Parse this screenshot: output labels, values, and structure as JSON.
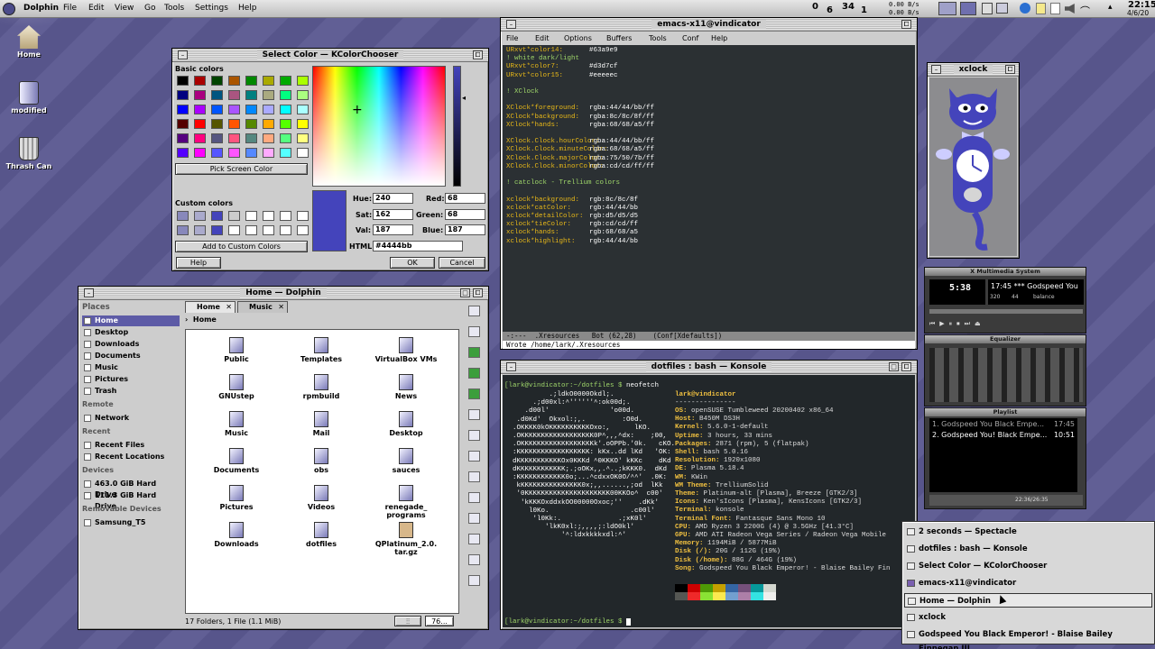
{
  "panel": {
    "app": "Dolphin",
    "menus": [
      "File",
      "Edit",
      "View",
      "Go",
      "Tools",
      "Settings",
      "Help"
    ],
    "net1": "0.00 B/s",
    "net2": "0.00 B/s",
    "clock_time": "22:15",
    "clock_date": "4/6/20",
    "indicator_a": "0",
    "indicator_b": "6",
    "indicator_c": "34",
    "indicator_d": "1"
  },
  "desktop": {
    "icons": [
      {
        "label": "Home"
      },
      {
        "label": "modified"
      },
      {
        "label": "Thrash Can"
      }
    ]
  },
  "colorchooser": {
    "title": "Select Color — KColorChooser",
    "basic_label": "Basic colors",
    "pick_label": "Pick Screen Color",
    "custom_label": "Custom colors",
    "add_label": "Add to Custom Colors",
    "hue_label": "Hue:",
    "hue": "240",
    "sat_label": "Sat:",
    "sat": "162",
    "val_label": "Val:",
    "val": "187",
    "red_label": "Red:",
    "red": "68",
    "green_label": "Green:",
    "green": "68",
    "blue_label": "Blue:",
    "blue": "187",
    "html_label": "HTML:",
    "html": "#4444bb",
    "help": "Help",
    "ok": "OK",
    "cancel": "Cancel",
    "basic_colors": [
      "#000000",
      "#aa0000",
      "#004400",
      "#aa5500",
      "#008800",
      "#aaaa00",
      "#00aa00",
      "#aaff00",
      "#000080",
      "#aa0080",
      "#005580",
      "#aa5580",
      "#008080",
      "#aaaa80",
      "#00ff80",
      "#aaff80",
      "#0000ff",
      "#aa00ff",
      "#0055ff",
      "#aa55ff",
      "#0088ff",
      "#aaaaff",
      "#00ffff",
      "#aaffff",
      "#550000",
      "#ff0000",
      "#555500",
      "#ff5500",
      "#558800",
      "#ffaa00",
      "#55ff00",
      "#ffff00",
      "#550080",
      "#ff0080",
      "#555580",
      "#ff5580",
      "#558880",
      "#ffaa80",
      "#55ff80",
      "#ffff80",
      "#5500ff",
      "#ff00ff",
      "#5555ff",
      "#ff55ff",
      "#5588ff",
      "#ffaaff",
      "#55ffff",
      "#ffffff"
    ],
    "custom_colors": [
      "#8888bb",
      "#aaaacc",
      "#4444bb",
      "#cccccc",
      "#ffffff",
      "#ffffff",
      "#ffffff",
      "#ffffff",
      "#8888bb",
      "#aaaacc",
      "#4444bb",
      "#ffffff",
      "#ffffff",
      "#ffffff",
      "#ffffff",
      "#ffffff"
    ]
  },
  "emacs": {
    "title": "emacs-x11@vindicator",
    "menus": [
      "File",
      "Edit",
      "Options",
      "Buffers",
      "Tools",
      "Conf",
      "Help"
    ],
    "lines": [
      {
        "k": "URxvt*color14:",
        "v": "#63a9e9"
      },
      {
        "c": "! white dark/light"
      },
      {
        "k": "URxvt*color7:",
        "v": "#d3d7cf"
      },
      {
        "k": "URxvt*color15:",
        "v": "#eeeeec"
      },
      {
        "c": ""
      },
      {
        "c": "! XClock"
      },
      {
        "c": ""
      },
      {
        "k": "XClock*foreground:",
        "v": "rgba:44/44/bb/ff"
      },
      {
        "k": "XClock*background:",
        "v": "rgba:8c/8c/8f/ff"
      },
      {
        "k": "XClock*hands:",
        "v": "rgba:68/68/a5/ff"
      },
      {
        "c": ""
      },
      {
        "k": "XClock.Clock.hourColor:",
        "v": "rgba:44/44/bb/ff"
      },
      {
        "k": "XClock.Clock.minuteColor:",
        "v": "rgba:68/68/a5/ff"
      },
      {
        "k": "XClock.Clock.majorColor:",
        "v": "rgba:75/50/7b/ff"
      },
      {
        "k": "XClock.Clock.minorColor:",
        "v": "rgba:cd/cd/ff/ff"
      },
      {
        "c": ""
      },
      {
        "c": "! catclock - Trellium colors"
      },
      {
        "c": ""
      },
      {
        "k": "xclock*background:",
        "v": "rgb:8c/8c/8f"
      },
      {
        "k": "xclock*catColor:",
        "v": "rgb:44/44/bb"
      },
      {
        "k": "xclock*detailColor:",
        "v": "rgb:d5/d5/d5"
      },
      {
        "k": "xclock*tieColor:",
        "v": "rgb:cd/cd/ff"
      },
      {
        "k": "xclock*hands:",
        "v": "rgb:68/68/a5"
      },
      {
        "k": "xclock*highlight:",
        "v": "rgb:44/44/bb"
      }
    ],
    "modeline": "-:---  .Xresources   Bot (62,28)    (Conf[Xdefaults])",
    "echo": "Wrote /home/lark/.Xresources"
  },
  "xclock": {
    "title": "xclock"
  },
  "dolphin": {
    "title": "Home — Dolphin",
    "places_label": "Places",
    "places": [
      "Home",
      "Desktop",
      "Downloads",
      "Documents",
      "Music",
      "Pictures",
      "Trash"
    ],
    "remote_label": "Remote",
    "remote": [
      "Network"
    ],
    "recent_label": "Recent",
    "recent": [
      "Recent Files",
      "Recent Locations"
    ],
    "devices_label": "Devices",
    "devices": [
      "463.0 GiB Hard Drive",
      "111.3 GiB Hard Drive"
    ],
    "removable_label": "Removable Devices",
    "removable": [
      "Samsung_T5"
    ],
    "tabs": [
      "Home",
      "Music"
    ],
    "breadcrumb": "Home",
    "files": [
      "Public",
      "Templates",
      "VirtualBox VMs",
      "GNUstep",
      "rpmbuild",
      "News",
      "Music",
      "Mail",
      "Desktop",
      "Documents",
      "obs",
      "sauces",
      "Pictures",
      "Videos",
      "renegade_ programs",
      "Downloads",
      "dotfiles",
      "QPlatinum_2.0. tar.gz"
    ],
    "status": "17 Folders, 1 File (1.1 MiB)",
    "zoom": "76..."
  },
  "konsole": {
    "title": "dotfiles : bash — Konsole",
    "prompt": "[lark@vindicator:~/dotfiles $",
    "cmd": "neofetch",
    "userhost": "lark@vindicator",
    "sep": "---------------",
    "info": [
      {
        "k": "OS",
        "v": "openSUSE Tumbleweed 20200402 x86_64"
      },
      {
        "k": "Host",
        "v": "B450M DS3H"
      },
      {
        "k": "Kernel",
        "v": "5.6.0-1-default"
      },
      {
        "k": "Uptime",
        "v": "3 hours, 33 mins"
      },
      {
        "k": "Packages",
        "v": "2871 (rpm), 5 (flatpak)"
      },
      {
        "k": "Shell",
        "v": "bash 5.0.16"
      },
      {
        "k": "Resolution",
        "v": "1920x1080"
      },
      {
        "k": "DE",
        "v": "Plasma 5.18.4"
      },
      {
        "k": "WM",
        "v": "KWin"
      },
      {
        "k": "WM Theme",
        "v": "TrelliumSolid"
      },
      {
        "k": "Theme",
        "v": "Platinum-alt [Plasma], Breeze [GTK2/3]"
      },
      {
        "k": "Icons",
        "v": "Ken'sIcons [Plasma], KensIcons [GTK2/3]"
      },
      {
        "k": "Terminal",
        "v": "konsole"
      },
      {
        "k": "Terminal Font",
        "v": "Fantasque Sans Mono 10"
      },
      {
        "k": "CPU",
        "v": "AMD Ryzen 3 2200G (4) @ 3.5GHz [41.3°C]"
      },
      {
        "k": "GPU",
        "v": "AMD ATI Radeon Vega Series / Radeon Vega Mobile"
      },
      {
        "k": "Memory",
        "v": "1194MiB / 5877MiB"
      },
      {
        "k": "Disk (/)",
        "v": "20G / 112G (19%)"
      },
      {
        "k": "Disk (/home)",
        "v": "88G / 464G (19%)"
      },
      {
        "k": "Song",
        "v": "Godspeed You Black Emperor! - Blaise Bailey Fin"
      }
    ],
    "logo": [
      "           .;ldkO0000Okdl;.",
      "       .;d00xl:^''''''^:ok00d;.",
      "     .d00l'               'o00d.",
      "   .d0Kd'  Okxol:;,.         :O0d.",
      "  .OKKKK0kOKKKKKKKKKKOxo:,      lKO.",
      "  .OKKKKKKKKKKKKKKKKKK0P^,,,^dx:    ;00,",
      "  .OKKKKKKKKKKKKKKKKKKk'.oOPPb.'0k.   cKO.",
      "  :KKKKKKKKKKKKKKKKKK: kKx..dd lKd   'OK:",
      "  dKKKKKKKKKKKOx0KKKd ^0KKKO' kKKc    dKd",
      "  dKKKKKKKKKKKK;.;oOKx,,.^..;kKKK0.  dKd",
      "  :KKKKKKKKKKKK0o;...^cdxxOK0O/^^'  .0K:",
      "   kKKKKKKKKKKKKKKK0x;,,......,;od  lKk",
      "   '0KKKKKKKKKKKKKKKKKKKKK00KKOo^  c00'",
      "    'kKKKOxddxkOO00000Oxoc;''    .dKk'",
      "      l0Ko.                    .c00l'",
      "       'l0Kk:.              .;xK0l'",
      "          'lkK0xl:;,,,,;:ldO0kl'",
      "              '^:ldxkkkkxdl:^'"
    ],
    "prompt2": "[lark@vindicator:~/dotfiles $",
    "palette": [
      "#000000",
      "#cc0000",
      "#4e9a06",
      "#c4a000",
      "#3465a4",
      "#75507b",
      "#06989a",
      "#d3d7cf",
      "#555753",
      "#ef2929",
      "#8ae234",
      "#fce94f",
      "#729fcf",
      "#ad7fa8",
      "#34e2e2",
      "#eeeeec"
    ]
  },
  "xmms": {
    "title": "X Multimedia System",
    "time": "5:38",
    "track": "17:45 *** Godspeed You",
    "kbps": "320",
    "khz": "44",
    "balance": "balance",
    "eq_title": "Equalizer",
    "playlist_title": "Playlist",
    "playlist": [
      {
        "t": "1. Godspeed You Black Empe...",
        "d": "17:45"
      },
      {
        "t": "2. Godspeed You! Black Empe...",
        "d": "10:51"
      }
    ],
    "pl_time": "22:36/26:35"
  },
  "taskmenu": {
    "items": [
      "2 seconds — Spectacle",
      "dotfiles : bash — Konsole",
      "Select Color — KColorChooser",
      "emacs-x11@vindicator",
      "Home — Dolphin",
      "xclock",
      "Godspeed You Black Emperor! - Blaise Bailey Finnegan III"
    ]
  },
  "colors": {
    "accent": "#4444bb",
    "selection": "#5d5ba6",
    "term_bg": "#2b3033",
    "emacs_key": "#e8b818",
    "emacs_val": "#ffffff",
    "emacs_comment": "#9fd66a"
  }
}
